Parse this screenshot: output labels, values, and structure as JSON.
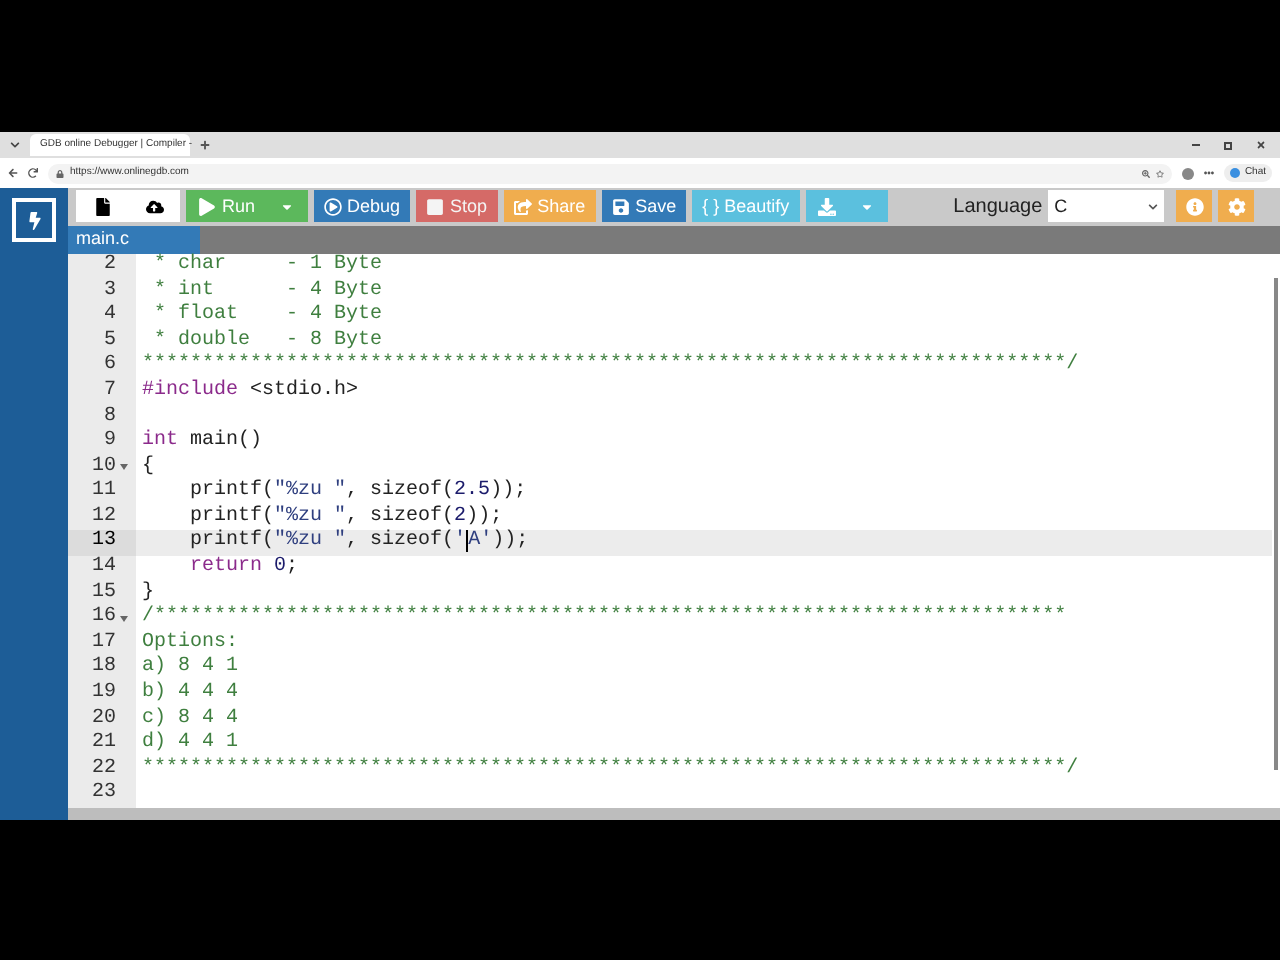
{
  "browser": {
    "tab_title": "GDB online Debugger | Compiler -",
    "url": "https://www.onlinegdb.com",
    "chat_label": "Chat"
  },
  "toolbar": {
    "buttons": [
      {
        "kind": "icon"
      },
      {
        "kind": "icon"
      },
      {
        "kind": "split",
        "label": "Run"
      },
      {
        "kind": "text",
        "label": "Debug"
      },
      {
        "kind": "text",
        "label": "Stop"
      },
      {
        "kind": "text",
        "label": "Share"
      },
      {
        "kind": "text",
        "label": "Save"
      },
      {
        "kind": "text",
        "label": "{ } Beautify"
      },
      {
        "kind": "split"
      }
    ],
    "language_label": "Language",
    "language_value": "C"
  },
  "file_tabs": [
    {
      "label": "main.c",
      "selected": true
    }
  ],
  "editor": {
    "lines": [
      {
        "number": "2",
        "fold": false,
        "active": false,
        "segments": [
          {
            "kind": "comment",
            "text": " * char     - 1 Byte"
          }
        ]
      },
      {
        "number": "3",
        "fold": false,
        "active": false,
        "segments": [
          {
            "kind": "comment",
            "text": " * int      - 4 Byte"
          }
        ]
      },
      {
        "number": "4",
        "fold": false,
        "active": false,
        "segments": [
          {
            "kind": "comment",
            "text": " * float    - 4 Byte"
          }
        ]
      },
      {
        "number": "5",
        "fold": false,
        "active": false,
        "segments": [
          {
            "kind": "comment",
            "text": " * double   - 8 Byte"
          }
        ]
      },
      {
        "number": "6",
        "fold": false,
        "active": false,
        "segments": [
          {
            "kind": "comment",
            "text": "*****************************************************************************/"
          }
        ]
      },
      {
        "number": "7",
        "fold": false,
        "active": false,
        "segments": [
          {
            "kind": "keyword",
            "text": "#include"
          },
          {
            "kind": "plain",
            "text": " <stdio.h>"
          }
        ]
      },
      {
        "number": "8",
        "fold": false,
        "active": false
      },
      {
        "number": "9",
        "fold": false,
        "active": false,
        "segments": [
          {
            "kind": "keyword",
            "text": "int"
          },
          {
            "kind": "plain",
            "text": " main()"
          }
        ]
      },
      {
        "number": "10",
        "fold": true,
        "active": false,
        "segments": [
          {
            "kind": "plain",
            "text": "{"
          }
        ]
      },
      {
        "number": "11",
        "fold": false,
        "active": false,
        "segments": [
          {
            "kind": "plain",
            "text": "    printf("
          },
          {
            "kind": "string",
            "text": "\"%zu \""
          },
          {
            "kind": "plain",
            "text": ", sizeof("
          },
          {
            "kind": "number",
            "text": "2.5"
          },
          {
            "kind": "plain",
            "text": "));"
          }
        ]
      },
      {
        "number": "12",
        "fold": false,
        "active": false,
        "segments": [
          {
            "kind": "plain",
            "text": "    printf("
          },
          {
            "kind": "string",
            "text": "\"%zu \""
          },
          {
            "kind": "plain",
            "text": ", sizeof("
          },
          {
            "kind": "number",
            "text": "2"
          },
          {
            "kind": "plain",
            "text": "));"
          }
        ]
      },
      {
        "number": "13",
        "fold": false,
        "active": true,
        "segments": [
          {
            "kind": "plain",
            "text": "    printf("
          },
          {
            "kind": "string",
            "text": "\"%zu \""
          },
          {
            "kind": "plain",
            "text": ", sizeof("
          },
          {
            "kind": "string",
            "text": "'"
          },
          {
            "kind": "string",
            "text": "A'",
            "cursor_before": true
          },
          {
            "kind": "plain",
            "text": "));"
          }
        ]
      },
      {
        "number": "14",
        "fold": false,
        "active": false,
        "segments": [
          {
            "kind": "keyword",
            "text": "    return"
          },
          {
            "kind": "number",
            "text": " 0"
          },
          {
            "kind": "plain",
            "text": ";"
          }
        ]
      },
      {
        "number": "15",
        "fold": false,
        "active": false,
        "segments": [
          {
            "kind": "plain",
            "text": "}"
          }
        ]
      },
      {
        "number": "16",
        "fold": true,
        "active": false,
        "segments": [
          {
            "kind": "comment",
            "text": "/****************************************************************************"
          }
        ]
      },
      {
        "number": "17",
        "fold": false,
        "active": false,
        "segments": [
          {
            "kind": "comment",
            "text": "Options:"
          }
        ]
      },
      {
        "number": "18",
        "fold": false,
        "active": false,
        "segments": [
          {
            "kind": "comment",
            "text": "a) 8 4 1"
          }
        ]
      },
      {
        "number": "19",
        "fold": false,
        "active": false,
        "segments": [
          {
            "kind": "comment",
            "text": "b) 4 4 4"
          }
        ]
      },
      {
        "number": "20",
        "fold": false,
        "active": false,
        "segments": [
          {
            "kind": "comment",
            "text": "c) 8 4 4"
          }
        ]
      },
      {
        "number": "21",
        "fold": false,
        "active": false,
        "segments": [
          {
            "kind": "comment",
            "text": "d) 4 4 1"
          }
        ]
      },
      {
        "number": "22",
        "fold": false,
        "active": false,
        "segments": [
          {
            "kind": "comment",
            "text": "*****************************************************************************/"
          }
        ]
      },
      {
        "number": "23",
        "fold": false,
        "active": false
      }
    ]
  }
}
